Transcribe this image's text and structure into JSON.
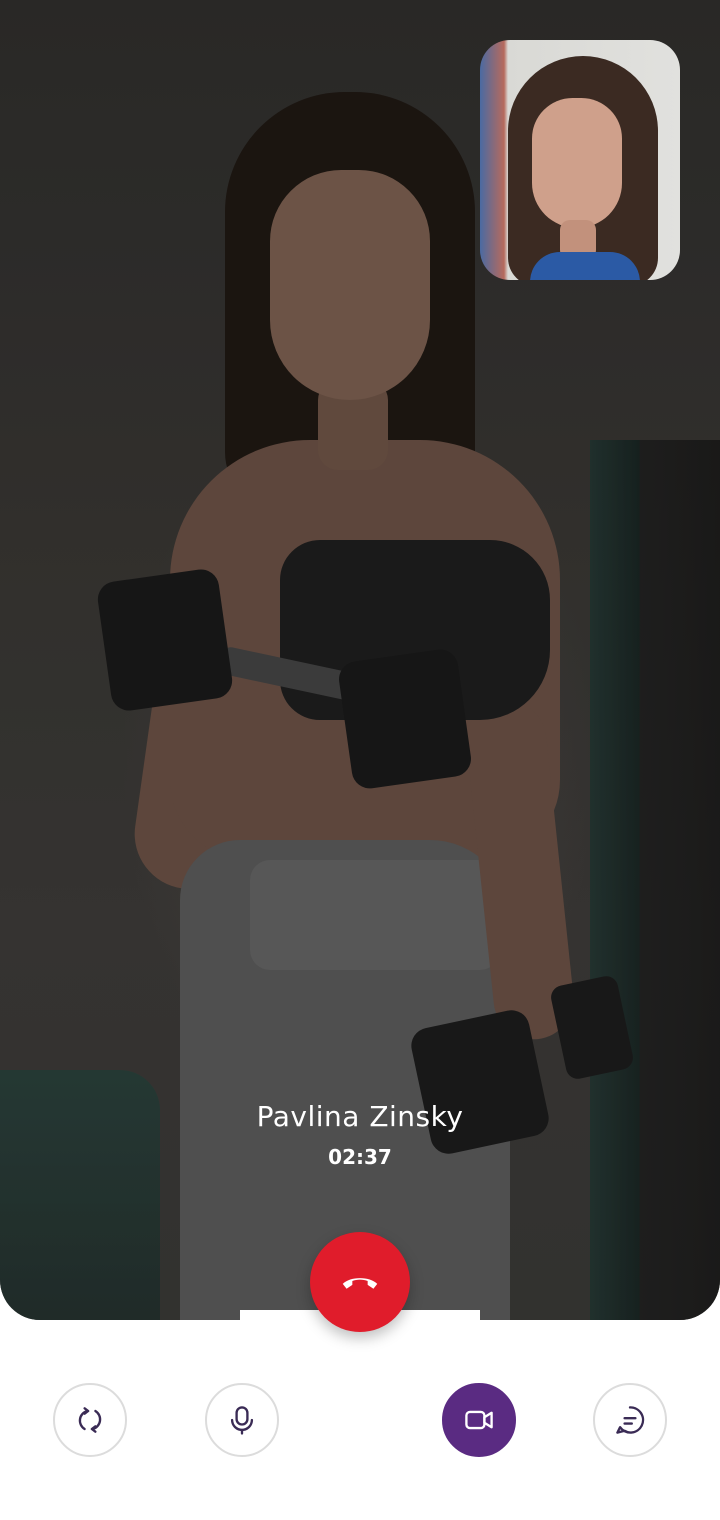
{
  "call": {
    "caller_name": "Pavlina Zinsky",
    "duration": "02:37"
  },
  "controls": {
    "switch_camera_icon": "rotate-icon",
    "mic_icon": "microphone-icon",
    "video_icon": "video-camera-icon",
    "chat_icon": "chat-bubble-icon",
    "end_call_icon": "phone-hangup-icon"
  },
  "colors": {
    "end_call": "#e01c2b",
    "video_active": "#5a2b82",
    "control_border": "#dcdcdc"
  }
}
